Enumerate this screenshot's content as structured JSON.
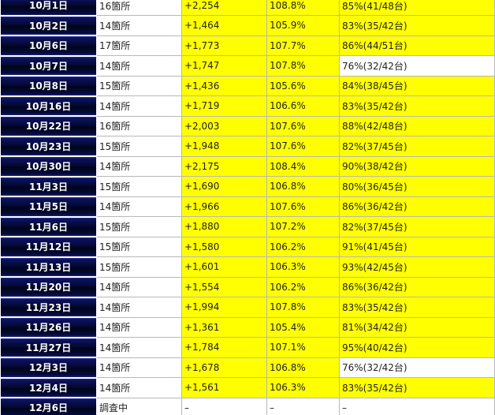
{
  "colors": {
    "highlight": "#ffff00",
    "plain": "#ffffff",
    "date_header": "#040832"
  },
  "rows": [
    {
      "date": "10月1日",
      "count": "16箇所",
      "diff": "+2,254",
      "rate": "108.8%",
      "win": "85%(41/48台)",
      "hl_diff": true,
      "hl_win": true
    },
    {
      "date": "10月2日",
      "count": "14箇所",
      "diff": "+1,464",
      "rate": "105.9%",
      "win": "83%(35/42台)",
      "hl_diff": true,
      "hl_win": true
    },
    {
      "date": "10月6日",
      "count": "17箇所",
      "diff": "+1,773",
      "rate": "107.7%",
      "win": "86%(44/51台)",
      "hl_diff": true,
      "hl_win": true
    },
    {
      "date": "10月7日",
      "count": "14箇所",
      "diff": "+1,747",
      "rate": "107.8%",
      "win": "76%(32/42台)",
      "hl_diff": true,
      "hl_win": false
    },
    {
      "date": "10月8日",
      "count": "15箇所",
      "diff": "+1,436",
      "rate": "105.6%",
      "win": "84%(38/45台)",
      "hl_diff": true,
      "hl_win": true
    },
    {
      "date": "10月16日",
      "count": "14箇所",
      "diff": "+1,719",
      "rate": "106.6%",
      "win": "83%(35/42台)",
      "hl_diff": true,
      "hl_win": true
    },
    {
      "date": "10月22日",
      "count": "16箇所",
      "diff": "+2,003",
      "rate": "107.6%",
      "win": "88%(42/48台)",
      "hl_diff": true,
      "hl_win": true
    },
    {
      "date": "10月23日",
      "count": "15箇所",
      "diff": "+1,948",
      "rate": "107.6%",
      "win": "82%(37/45台)",
      "hl_diff": true,
      "hl_win": true
    },
    {
      "date": "10月30日",
      "count": "14箇所",
      "diff": "+2,175",
      "rate": "108.4%",
      "win": "90%(38/42台)",
      "hl_diff": true,
      "hl_win": true
    },
    {
      "date": "11月3日",
      "count": "15箇所",
      "diff": "+1,690",
      "rate": "106.8%",
      "win": "80%(36/45台)",
      "hl_diff": true,
      "hl_win": true
    },
    {
      "date": "11月5日",
      "count": "14箇所",
      "diff": "+1,966",
      "rate": "107.6%",
      "win": "86%(36/42台)",
      "hl_diff": true,
      "hl_win": true
    },
    {
      "date": "11月6日",
      "count": "15箇所",
      "diff": "+1,880",
      "rate": "107.2%",
      "win": "82%(37/45台)",
      "hl_diff": true,
      "hl_win": true
    },
    {
      "date": "11月12日",
      "count": "15箇所",
      "diff": "+1,580",
      "rate": "106.2%",
      "win": "91%(41/45台)",
      "hl_diff": true,
      "hl_win": true
    },
    {
      "date": "11月13日",
      "count": "15箇所",
      "diff": "+1,601",
      "rate": "106.3%",
      "win": "93%(42/45台)",
      "hl_diff": true,
      "hl_win": true
    },
    {
      "date": "11月20日",
      "count": "14箇所",
      "diff": "+1,554",
      "rate": "106.2%",
      "win": "86%(36/42台)",
      "hl_diff": true,
      "hl_win": true
    },
    {
      "date": "11月23日",
      "count": "14箇所",
      "diff": "+1,994",
      "rate": "107.8%",
      "win": "83%(35/42台)",
      "hl_diff": true,
      "hl_win": true
    },
    {
      "date": "11月26日",
      "count": "14箇所",
      "diff": "+1,361",
      "rate": "105.4%",
      "win": "81%(34/42台)",
      "hl_diff": true,
      "hl_win": true
    },
    {
      "date": "11月27日",
      "count": "14箇所",
      "diff": "+1,784",
      "rate": "107.1%",
      "win": "95%(40/42台)",
      "hl_diff": true,
      "hl_win": true
    },
    {
      "date": "12月3日",
      "count": "14箇所",
      "diff": "+1,678",
      "rate": "106.8%",
      "win": "76%(32/42台)",
      "hl_diff": true,
      "hl_win": false
    },
    {
      "date": "12月4日",
      "count": "14箇所",
      "diff": "+1,561",
      "rate": "106.3%",
      "win": "83%(35/42台)",
      "hl_diff": true,
      "hl_win": true
    },
    {
      "date": "12月6日",
      "count": "調査中",
      "diff": "–",
      "rate": "–",
      "win": "–",
      "hl_diff": false,
      "hl_win": false
    }
  ]
}
